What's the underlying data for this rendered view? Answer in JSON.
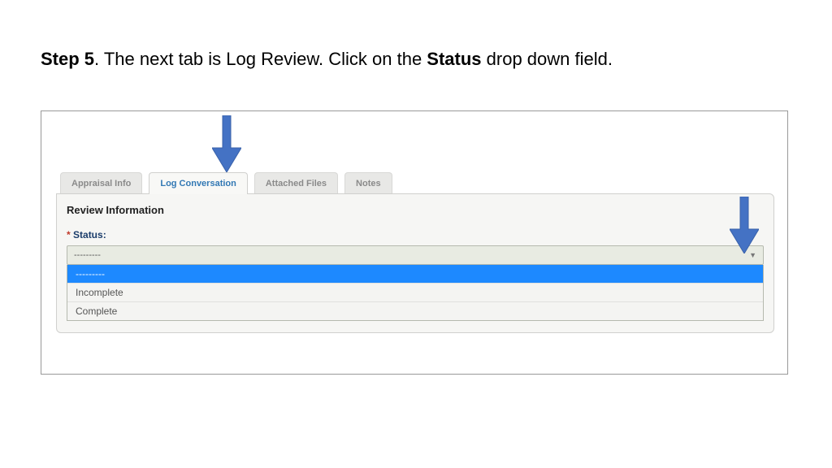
{
  "instruction": {
    "step_prefix": "Step 5",
    "text_before_status": ".  The next tab is Log Review.  Click on the ",
    "status_word": "Status",
    "text_after_status": " drop down field."
  },
  "tabs": {
    "appraisal": "Appraisal Info",
    "log_conversation": "Log Conversation",
    "attached_files": "Attached Files",
    "notes": "Notes"
  },
  "panel": {
    "section_title": "Review Information",
    "required_marker": "*",
    "status_label": "Status:",
    "select_value": "---------",
    "option_blank": "---------",
    "option_incomplete": "Incomplete",
    "option_complete": "Complete"
  }
}
